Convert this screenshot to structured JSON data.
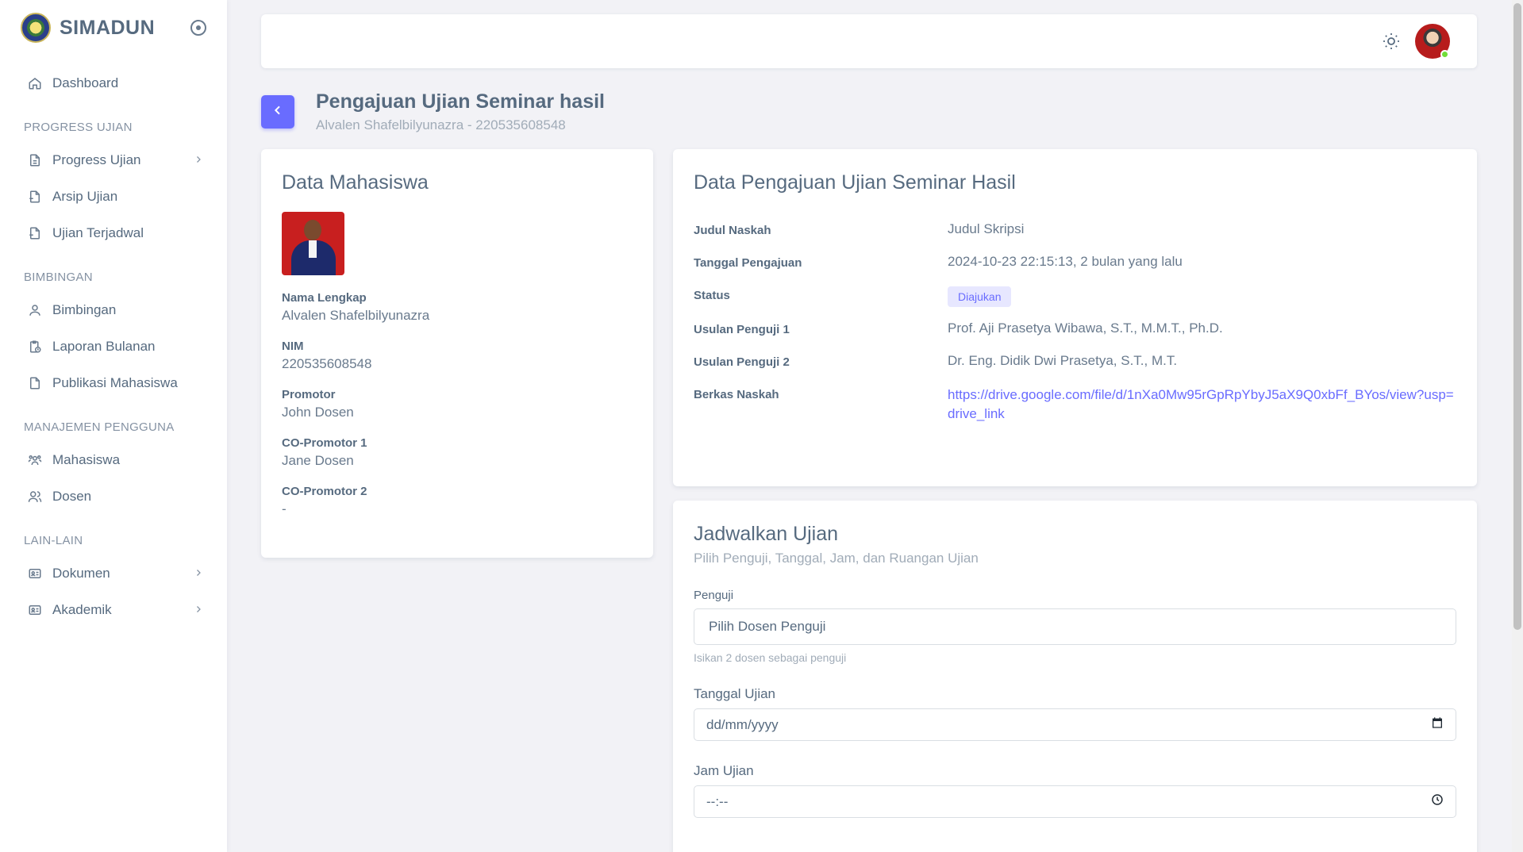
{
  "brand": {
    "name": "SIMADUN"
  },
  "sidebar": {
    "items": [
      {
        "label": "Dashboard"
      }
    ],
    "sections": [
      {
        "header": "PROGRESS UJIAN",
        "items": [
          "Progress Ujian",
          "Arsip Ujian",
          "Ujian Terjadwal"
        ]
      },
      {
        "header": "BIMBINGAN",
        "items": [
          "Bimbingan",
          "Laporan Bulanan",
          "Publikasi Mahasiswa"
        ]
      },
      {
        "header": "MANAJEMEN PENGGUNA",
        "items": [
          "Mahasiswa",
          "Dosen"
        ]
      },
      {
        "header": "LAIN-LAIN",
        "items": [
          "Dokumen",
          "Akademik"
        ]
      }
    ]
  },
  "page": {
    "title": "Pengajuan Ujian Seminar hasil",
    "subtitle": "Alvalen Shafelbilyunazra - 220535608548"
  },
  "mahasiswa": {
    "title": "Data Mahasiswa",
    "fields": [
      {
        "label": "Nama Lengkap",
        "value": "Alvalen Shafelbilyunazra"
      },
      {
        "label": "NIM",
        "value": "220535608548"
      },
      {
        "label": "Promotor",
        "value": "John Dosen"
      },
      {
        "label": "CO-Promotor 1",
        "value": "Jane Dosen"
      },
      {
        "label": "CO-Promotor 2",
        "value": "-"
      }
    ]
  },
  "pengajuan": {
    "title": "Data Pengajuan Ujian Seminar Hasil",
    "rows": [
      {
        "label": "Judul Naskah",
        "value": "Judul Skripsi"
      },
      {
        "label": "Tanggal Pengajuan",
        "value": "2024-10-23 22:15:13, 2 bulan yang lalu"
      },
      {
        "label": "Status",
        "value": "Diajukan"
      },
      {
        "label": "Usulan Penguji 1",
        "value": "Prof. Aji Prasetya Wibawa, S.T., M.M.T., Ph.D."
      },
      {
        "label": "Usulan Penguji 2",
        "value": "Dr. Eng. Didik Dwi Prasetya, S.T., M.T."
      },
      {
        "label": "Berkas Naskah",
        "value": "https://drive.google.com/file/d/1nXa0Mw95rGpRpYbyJ5aX9Q0xbFf_BYos/view?usp=drive_link"
      }
    ]
  },
  "jadwal": {
    "title": "Jadwalkan Ujian",
    "subtitle": "Pilih Penguji, Tanggal, Jam, dan Ruangan Ujian",
    "penguji_label": "Penguji",
    "penguji_placeholder": "Pilih Dosen Penguji",
    "penguji_help": "Isikan 2 dosen sebagai penguji",
    "tanggal_label": "Tanggal Ujian",
    "tanggal_placeholder": "dd/mm/yyyy",
    "jam_label": "Jam Ujian",
    "jam_placeholder": "--:--"
  },
  "colors": {
    "primary": "#696cff",
    "text": "#566a7f",
    "muted": "#a1acb8"
  },
  "icons": [
    "home-icon",
    "file-icon",
    "user-icon",
    "users-icon",
    "calendar-icon",
    "clock-icon",
    "sun-icon",
    "chevron-left-icon",
    "chevron-right-icon"
  ]
}
